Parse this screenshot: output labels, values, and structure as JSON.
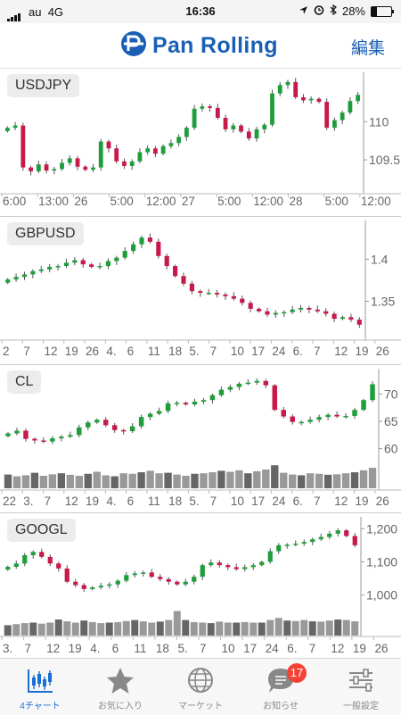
{
  "status": {
    "carrier": "au",
    "network": "4G",
    "time": "16:36",
    "battery": "28%"
  },
  "header": {
    "title": "Pan Rolling",
    "edit_label": "編集"
  },
  "colors": {
    "up": "#1e9e3a",
    "down": "#c8194b",
    "accent": "#1a5fb4",
    "tab_active": "#1a6fd6",
    "badge": "#f44336"
  },
  "panels": [
    {
      "symbol": "USDJPY",
      "y_ticks": [
        "110",
        "109.5"
      ],
      "x_ticks": [
        "6:00",
        "13:00",
        "26",
        "5:00",
        "12:00",
        "27",
        "5:00",
        "12:00",
        "28",
        "5:00",
        "12:00"
      ],
      "price_range": [
        109.15,
        110.6
      ],
      "volume": false,
      "series": [
        109.92,
        109.95,
        109.4,
        109.35,
        109.44,
        109.36,
        109.38,
        109.46,
        109.52,
        109.41,
        109.37,
        109.4,
        109.74,
        109.65,
        109.48,
        109.42,
        109.48,
        109.6,
        109.65,
        109.58,
        109.68,
        109.72,
        109.8,
        109.92,
        110.17,
        110.2,
        110.18,
        110.05,
        109.9,
        109.95,
        109.87,
        109.78,
        109.9,
        109.96,
        110.37,
        110.48,
        110.52,
        110.32,
        110.28,
        110.3,
        110.26,
        109.92,
        110.02,
        110.12,
        110.27,
        110.35
      ],
      "chart_data": {
        "type": "candlestick",
        "title": "USDJPY",
        "y_ticks": [
          110,
          109.5
        ]
      }
    },
    {
      "symbol": "GBPUSD",
      "y_ticks": [
        "1.4",
        "1.35"
      ],
      "x_ticks": [
        "2",
        "7",
        "12",
        "19",
        "26",
        "4.",
        "6",
        "11",
        "18",
        "5.",
        "7",
        "10",
        "17",
        "24",
        "6.",
        "7",
        "12",
        "19",
        "26"
      ],
      "price_range": [
        1.31,
        1.44
      ],
      "volume": false,
      "series": [
        1.376,
        1.379,
        1.382,
        1.386,
        1.388,
        1.391,
        1.392,
        1.396,
        1.399,
        1.394,
        1.391,
        1.392,
        1.398,
        1.402,
        1.41,
        1.418,
        1.426,
        1.421,
        1.404,
        1.392,
        1.38,
        1.371,
        1.362,
        1.36,
        1.36,
        1.358,
        1.356,
        1.353,
        1.348,
        1.341,
        1.338,
        1.334,
        1.336,
        1.337,
        1.34,
        1.342,
        1.34,
        1.338,
        1.335,
        1.329,
        1.331,
        1.328,
        1.322
      ],
      "chart_data": {
        "type": "candlestick",
        "title": "GBPUSD",
        "y_ticks": [
          1.4,
          1.35
        ]
      }
    },
    {
      "symbol": "CL",
      "y_ticks": [
        "70",
        "65",
        "60"
      ],
      "x_ticks": [
        "22",
        "3.",
        "7",
        "12",
        "19",
        "4.",
        "6",
        "11",
        "18",
        "5.",
        "7",
        "10",
        "17",
        "24",
        "6.",
        "7",
        "12",
        "19",
        "26"
      ],
      "price_range": [
        57,
        74
      ],
      "volume": true,
      "series": [
        62.8,
        63.3,
        61.8,
        61.5,
        61.3,
        61.9,
        62.2,
        62.5,
        63.9,
        64.8,
        65.3,
        64.3,
        63.4,
        63.2,
        64.1,
        65.8,
        66.4,
        66.9,
        68.3,
        68.4,
        68.1,
        68.6,
        68.9,
        69.8,
        70.8,
        71.3,
        71.9,
        72.1,
        72.4,
        71.6,
        67.1,
        65.9,
        64.9,
        64.9,
        65.3,
        65.8,
        66.2,
        65.9,
        66.0,
        67.1,
        68.9,
        71.8
      ],
      "volumes": [
        0.55,
        0.48,
        0.52,
        0.62,
        0.5,
        0.56,
        0.6,
        0.54,
        0.5,
        0.58,
        0.66,
        0.52,
        0.48,
        0.6,
        0.58,
        0.64,
        0.7,
        0.6,
        0.62,
        0.55,
        0.5,
        0.58,
        0.6,
        0.64,
        0.7,
        0.66,
        0.72,
        0.6,
        0.68,
        0.75,
        0.92,
        0.62,
        0.55,
        0.52,
        0.6,
        0.58,
        0.54,
        0.56,
        0.6,
        0.64,
        0.72,
        0.82
      ],
      "chart_data": {
        "type": "candlestick",
        "title": "CL",
        "y_ticks": [
          70,
          65,
          60
        ]
      }
    },
    {
      "symbol": "GOOGL",
      "y_ticks": [
        "1,200",
        "1,100",
        "1,000"
      ],
      "x_ticks": [
        "3.",
        "7",
        "12",
        "19",
        "4.",
        "6",
        "11",
        "18",
        "5.",
        "7",
        "10",
        "17",
        "24",
        "6.",
        "7",
        "12",
        "19",
        "26"
      ],
      "price_range": [
        945,
        1225
      ],
      "volume": true,
      "series": [
        1085,
        1095,
        1120,
        1130,
        1115,
        1095,
        1080,
        1040,
        1030,
        1018,
        1023,
        1028,
        1032,
        1043,
        1060,
        1065,
        1068,
        1055,
        1048,
        1040,
        1032,
        1040,
        1055,
        1090,
        1098,
        1090,
        1084,
        1078,
        1084,
        1090,
        1100,
        1132,
        1150,
        1152,
        1155,
        1160,
        1168,
        1175,
        1185,
        1195,
        1178,
        1150
      ],
      "volumes": [
        0.4,
        0.44,
        0.48,
        0.5,
        0.46,
        0.5,
        0.62,
        0.55,
        0.5,
        0.58,
        0.52,
        0.48,
        0.5,
        0.52,
        0.56,
        0.6,
        0.55,
        0.5,
        0.54,
        0.6,
        0.95,
        0.6,
        0.52,
        0.5,
        0.48,
        0.54,
        0.5,
        0.5,
        0.52,
        0.5,
        0.5,
        0.6,
        0.68,
        0.58,
        0.56,
        0.6,
        0.55,
        0.54,
        0.58,
        0.62,
        0.6,
        0.55
      ],
      "chart_data": {
        "type": "candlestick",
        "title": "GOOGL",
        "y_ticks": [
          1200,
          1100,
          1000
        ]
      }
    }
  ],
  "tabs": [
    {
      "label": "4チャート",
      "icon": "candlestick-chart-icon",
      "active": true
    },
    {
      "label": "お気に入り",
      "icon": "star-icon"
    },
    {
      "label": "マーケット",
      "icon": "globe-icon"
    },
    {
      "label": "お知らせ",
      "icon": "chat-bubble-icon",
      "badge": "17"
    },
    {
      "label": "一般設定",
      "icon": "sliders-icon"
    }
  ]
}
